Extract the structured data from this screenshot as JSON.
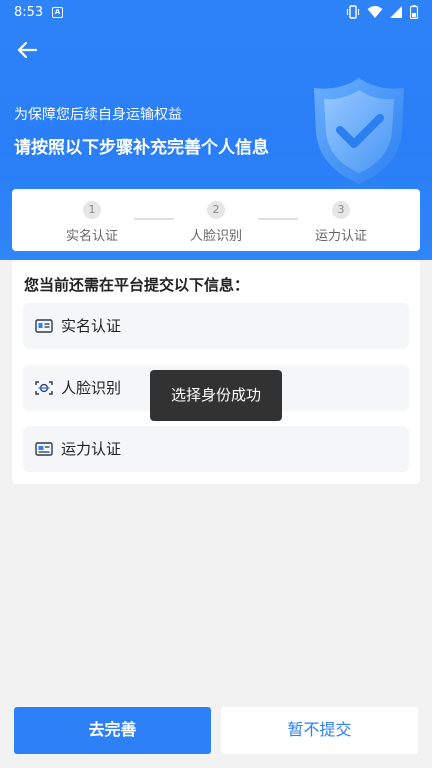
{
  "status_bar": {
    "time": "8:53",
    "notification_icon": "a-icon",
    "icons": [
      "vibrate-icon",
      "wifi-icon",
      "signal-icon",
      "battery-icon"
    ]
  },
  "header": {
    "back_icon": "arrow-left-icon",
    "subtitle": "为保障您后续自身运输权益",
    "title": "请按照以下步骤补充完善个人信息",
    "illustration": "shield-check-icon"
  },
  "steps": [
    {
      "number": "1",
      "label": "实名认证"
    },
    {
      "number": "2",
      "label": "人脸识别"
    },
    {
      "number": "3",
      "label": "运力认证"
    }
  ],
  "info": {
    "title": "您当前还需在平台提交以下信息：",
    "items": [
      {
        "label": "实名认证",
        "icon": "id-card-icon"
      },
      {
        "label": "人脸识别",
        "icon": "face-scan-icon"
      },
      {
        "label": "运力认证",
        "icon": "license-card-icon"
      }
    ]
  },
  "toast": {
    "text": "选择身份成功"
  },
  "buttons": {
    "complete": "去完善",
    "skip": "暂不提交"
  },
  "colors": {
    "primary": "#2d80f6",
    "background": "#f2f2f2"
  }
}
